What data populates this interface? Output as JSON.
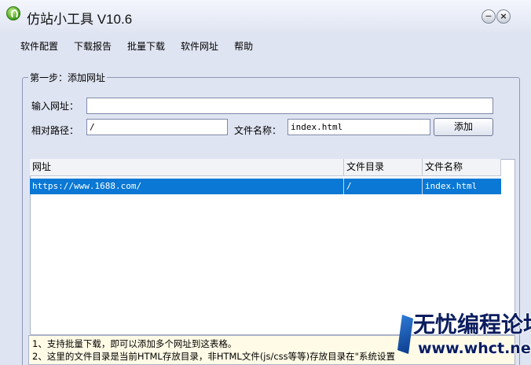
{
  "window": {
    "title": "仿站小工具 V10.6"
  },
  "menu": [
    "软件配置",
    "下载报告",
    "批量下载",
    "软件网址",
    "帮助"
  ],
  "step1": {
    "title": "第一步：添加网址",
    "url_label": "输入网址：",
    "url_value": "",
    "path_label": "相对路径：",
    "path_value": "/",
    "filename_label": "文件名称：",
    "filename_value": "index.html",
    "add_button": "添加"
  },
  "table": {
    "columns": [
      "网址",
      "文件目录",
      "文件名称"
    ],
    "rows": [
      {
        "url": "https://www.1688.com/",
        "dir": "/",
        "file": "index.html",
        "selected": true
      }
    ]
  },
  "notes": [
    "1、支持批量下载，即可以添加多个网址到这表格。",
    "2、这里的文件目录是当前HTML存放目录，非HTML文件(js/css等等)存放目录在\"系统设置"
  ],
  "watermark": {
    "text": "无忧编程论坛",
    "url": "www.whct.net"
  },
  "colors": {
    "selection": "#0a78d4",
    "background": "#dfe4f2"
  }
}
